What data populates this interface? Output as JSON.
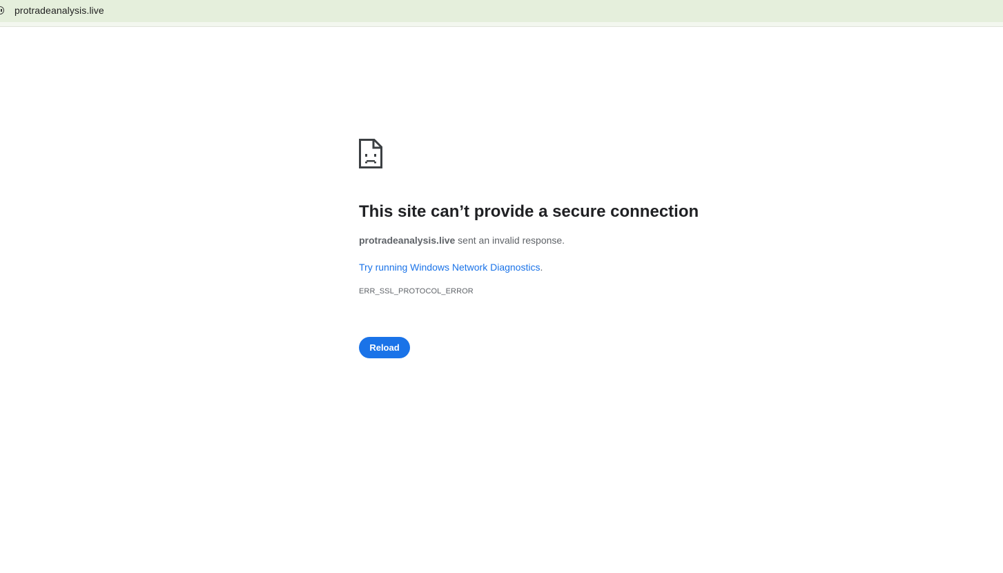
{
  "address_bar": {
    "url": "protradeanalysis.live",
    "background_color": "#e5efdc",
    "icon": "info-circle-icon"
  },
  "error_page": {
    "icon": "sad-page-icon",
    "headline": "This site can’t provide a secure connection",
    "summary": {
      "host": "protradeanalysis.live",
      "message": " sent an invalid response."
    },
    "suggestion": {
      "link_text": "Try running Windows Network Diagnostics",
      "suffix": "."
    },
    "error_code": "ERR_SSL_PROTOCOL_ERROR",
    "reload_label": "Reload",
    "accent_color": "#1a73e8"
  }
}
